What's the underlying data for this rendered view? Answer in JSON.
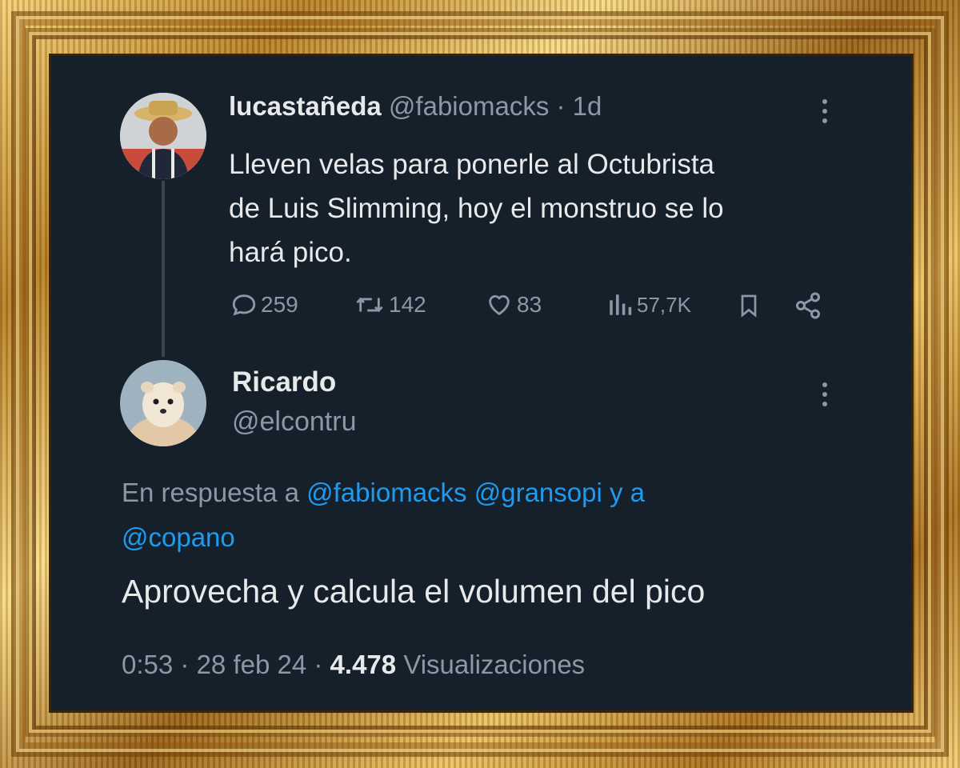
{
  "original_tweet": {
    "author_name": "lucastañeda",
    "handle": "@fabiomacks",
    "separator": "·",
    "age": "1d",
    "text_line1": "Lleven velas para ponerle al Octubrista",
    "text_line2": "de Luis Slimming, hoy el monstruo se lo",
    "text_line3": "hará pico.",
    "actions": {
      "replies": "259",
      "retweets": "142",
      "likes": "83",
      "views": "57,7K"
    },
    "icons": [
      "reply-icon",
      "retweet-icon",
      "like-icon",
      "views-icon",
      "bookmark-icon",
      "share-icon",
      "more-icon"
    ]
  },
  "reply_tweet": {
    "author_name": "Ricardo",
    "handle": "@elcontru",
    "reply_prefix": "En respuesta a",
    "mention1": "@fabiomacks",
    "mention2": "@gransopi",
    "reply_conjunction": "y a",
    "mention3": "@copano",
    "text": "Aprovecha y calcula el volumen del pico",
    "time": "0:53",
    "dot1": "·",
    "date": "28 feb 24",
    "dot2": "·",
    "views_count": "4.478",
    "views_label": "Visualizaciones"
  },
  "colors": {
    "background": "#15202b",
    "text": "#e7e9ea",
    "muted": "#8b98a5",
    "link": "#1d9bf0",
    "frame_gold": "#c9962e"
  }
}
